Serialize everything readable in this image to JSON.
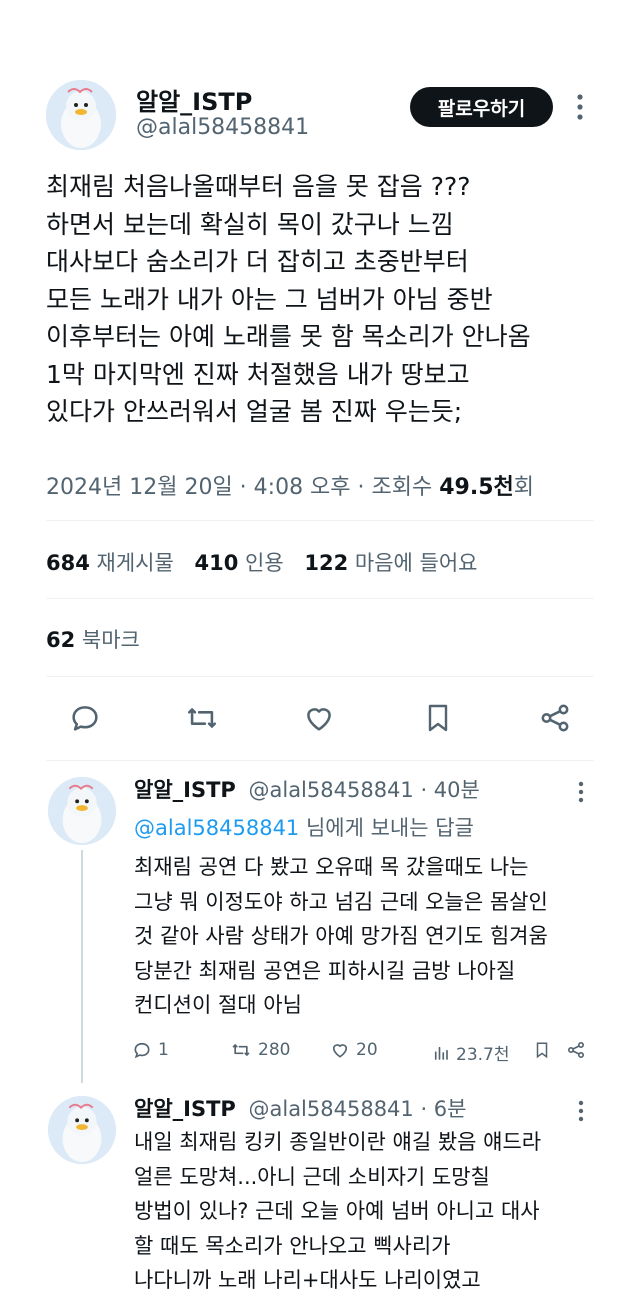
{
  "tweet": {
    "display_name": "알알_ISTP",
    "handle": "@alal58458841",
    "follow_label": "팔로우하기",
    "text": "최재림 처음나올때부터 음을 못 잡음 ???\n하면서 보는데 확실히 목이 갔구나 느낌\n대사보다 숨소리가 더 잡히고 초중반부터\n모든 노래가 내가 아는 그 넘버가 아님 중반\n이후부터는 아예 노래를 못 함 목소리가 안나옴\n1막 마지막엔 진짜 처절했음 내가 땅보고\n있다가 안쓰러워서 얼굴 봄 진짜 우는듯;",
    "meta_date": "2024년 12월 20일 · 4:08 오후 · 조회수 ",
    "views": "49.5천",
    "views_suffix": "회",
    "stats": {
      "retweets_num": "684",
      "retweets_label": "재게시물",
      "quotes_num": "410",
      "quotes_label": "인용",
      "likes_num": "122",
      "likes_label": "마음에 들어요",
      "bookmarks_num": "62",
      "bookmarks_label": "북마크"
    }
  },
  "replies": [
    {
      "display_name": "알알_ISTP",
      "handle_time": "@alal58458841 · 40분",
      "reply_to_mention": "@alal58458841",
      "reply_to_suffix": " 님에게 보내는 답글",
      "text": "최재림 공연 다 봤고 오유때 목 갔을때도 나는\n그냥 뭐 이정도야 하고 넘김 근데 오늘은 몸살인\n것 같아 사람 상태가 아예 망가짐 연기도 힘겨움\n당분간 최재림 공연은 피하시길 금방 나아질\n컨디션이 절대 아님",
      "replies_count": "1",
      "retweets_count": "280",
      "likes_count": "20",
      "views_count": "23.7천"
    },
    {
      "display_name": "알알_ISTP",
      "handle_time": "@alal58458841 · 6분",
      "text": "내일 최재림 킹키 종일반이란 얘길 봤음 얘드라\n얼른 도망쳐...아니 근데 소비자기 도망칠\n방법이 있나? 근데 오늘 아예 넘버 아니고 대사\n할 때도 목소리가 안나오고 삑사리가\n나다니까 노래 나리+대사도 나리이였고"
    }
  ],
  "icons": {
    "reply": "reply-icon",
    "retweet": "retweet-icon",
    "like": "heart-icon",
    "bookmark": "bookmark-icon",
    "share": "share-icon",
    "views": "views-icon",
    "more": "more-vertical-icon"
  },
  "colors": {
    "accent": "#1d9bf0",
    "text": "#0f1419",
    "muted": "#536471"
  }
}
